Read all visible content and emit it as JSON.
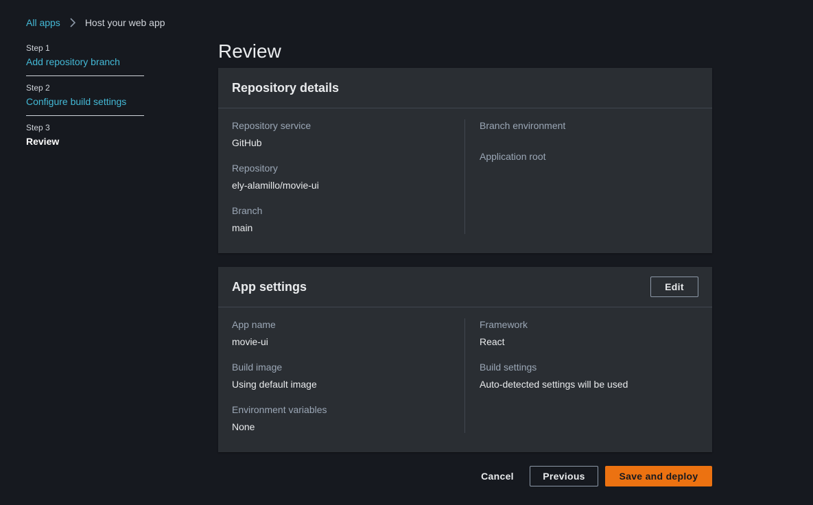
{
  "breadcrumb": {
    "root": "All apps",
    "current": "Host your web app"
  },
  "steps": [
    {
      "num": "Step 1",
      "label": "Add repository branch"
    },
    {
      "num": "Step 2",
      "label": "Configure build settings"
    },
    {
      "num": "Step 3",
      "label": "Review"
    }
  ],
  "page_title": "Review",
  "repository": {
    "title": "Repository details",
    "service_label": "Repository service",
    "service_value": "GitHub",
    "repo_label": "Repository",
    "repo_value": "ely-alamillo/movie-ui",
    "branch_label": "Branch",
    "branch_value": "main",
    "env_label": "Branch environment",
    "root_label": "Application root"
  },
  "app_settings": {
    "title": "App settings",
    "edit_label": "Edit",
    "name_label": "App name",
    "name_value": "movie-ui",
    "image_label": "Build image",
    "image_value": "Using default image",
    "envvars_label": "Environment variables",
    "envvars_value": "None",
    "framework_label": "Framework",
    "framework_value": "React",
    "build_settings_label": "Build settings",
    "build_settings_value": "Auto-detected settings will be used"
  },
  "footer": {
    "cancel": "Cancel",
    "previous": "Previous",
    "save": "Save and deploy"
  },
  "colors": {
    "background": "#16191f",
    "card": "#2a2e33",
    "link": "#44b9d6",
    "primary": "#ec7211"
  },
  "icons": {
    "breadcrumb_separator": "chevron-right-icon"
  }
}
